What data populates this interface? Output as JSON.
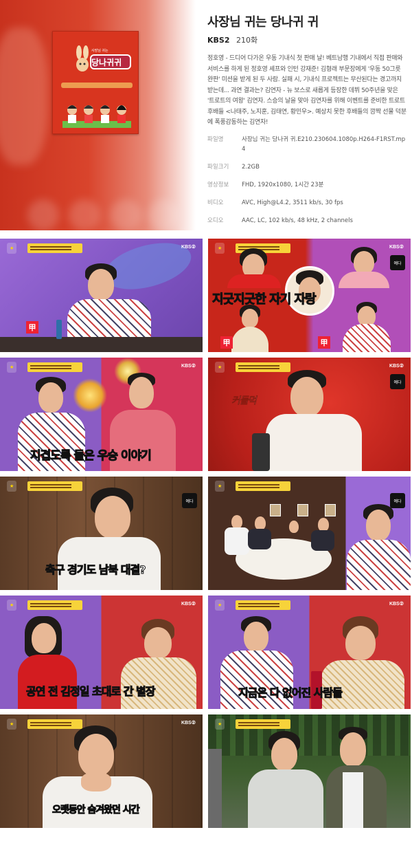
{
  "program": {
    "title": "사장님 귀는 당나귀 귀",
    "channel": "KBS2",
    "episode": "210화",
    "description": "정호영 - 드디어 다가온 우동 기내식 첫 판매 날! 베트남행 기내에서 직접 판매와 서비스를 하게 된 정호영 셰프와 인턴 강재준! 김형래 부문장에게 '우동 50그릇 완판' 미션을 받게 된 두 사람. 실패 시, 기내식 프로젝트는 무산된다는 경고까지 받는데... 과연 결과는? 김연자 - 뉴 보스로 새롭게 등장한 데뷔 50주년을 맞은 '트로트의 여왕' 김연자. 스승의 날을 맞아 김연자를 위해 이벤트를 준비한 트로트 후배들 <나태주, 노지훈, 김태연, 황민우>. 예상치 못한 후배들의 깜짝 선물 덕분에 폭풍감동하는 김연자!"
  },
  "poster": {
    "logo_text": "당나귀귀",
    "banner": "사장님 귀는"
  },
  "file_info": [
    {
      "key": "파일명",
      "value": "사장님 귀는 당나귀 귀.E210.230604.1080p.H264-F1RST.mp4"
    },
    {
      "key": "파일크기",
      "value": "2.2GB"
    },
    {
      "key": "영상정보",
      "value": "FHD, 1920x1080, 1시간 23분"
    },
    {
      "key": "비디오",
      "value": "AVC, High@L4.2, 3511 kb/s, 30 fps"
    },
    {
      "key": "오디오",
      "value": "AAC, LC, 102 kb/s, 48 kHz, 2 channels"
    }
  ],
  "screenshots": {
    "kbs": "KBS②",
    "badge_char": "甲",
    "emblem": "예다",
    "captions": [
      "",
      "지긋지긋한  자기 자랑",
      "지겹도록 들은 우승 이야기",
      "커들먹",
      "축구 경기도 남북 대결?",
      "",
      "",
      "공연 전 김정일 초대로 간 별장",
      "지금은 다 없어진 사람들",
      "오랫동안 숨겨왔던 시간"
    ]
  },
  "colors": {
    "studio_purple": "#8a5fc6",
    "studio_red": "#c8261b",
    "caption_yellow": "#ffe83a",
    "caption_green": "#7cf06a",
    "caption_white": "#ffffff"
  }
}
